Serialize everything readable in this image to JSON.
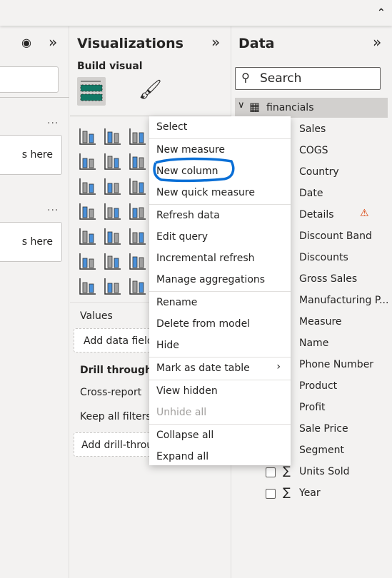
{
  "filters": {
    "box1_text": "Add data fields here",
    "box2_text": "Add data fields here",
    "more_label": "...",
    "box1_visible": "s here",
    "box2_visible": "s here"
  },
  "visualizations": {
    "title": "Visualizations",
    "build_visual": "Build visual",
    "values_label": "Values",
    "add_data_fields": "Add data fields here",
    "drill_through": "Drill through",
    "cross_report": "Cross-report",
    "keep_all_filters": "Keep all filters",
    "add_drill_through": "Add drill-through fields here",
    "icons": [
      "stacked-bar-chart",
      "stacked-column-chart",
      "clustered-bar-chart",
      "line-chart",
      "area-chart",
      "stacked-area-chart",
      "line-and-column-chart",
      "funnel-chart",
      "scatter-chart",
      "globe-map",
      "filled-map",
      "azure-map",
      "kpi",
      "slicer",
      "table",
      "decomposition-tree",
      "key-influencers",
      "smart-narrative",
      "card-new",
      "arcgis-map",
      "power-apps"
    ]
  },
  "data": {
    "title": "Data",
    "search_placeholder": "Search",
    "table_name": "financials",
    "fields": [
      {
        "label": "Sales",
        "sigma": true
      },
      {
        "label": "COGS",
        "sigma": true
      },
      {
        "label": "Country",
        "sigma": false
      },
      {
        "label": "Date",
        "sigma": false
      },
      {
        "label": "Details",
        "sigma": false,
        "warning": true
      },
      {
        "label": "Discount Band",
        "sigma": false
      },
      {
        "label": "Discounts",
        "sigma": true
      },
      {
        "label": "Gross Sales",
        "sigma": true
      },
      {
        "label": "Manufacturing P...",
        "sigma": true
      },
      {
        "label": "Measure",
        "sigma": false
      },
      {
        "label": "Name",
        "sigma": false
      },
      {
        "label": "Phone Number",
        "sigma": false
      },
      {
        "label": "Product",
        "sigma": false
      },
      {
        "label": "Profit",
        "sigma": true
      },
      {
        "label": "Sale Price",
        "sigma": true
      },
      {
        "label": "Segment",
        "sigma": false
      },
      {
        "label": "Units Sold",
        "sigma": true
      },
      {
        "label": "Year",
        "sigma": true
      }
    ]
  },
  "context_menu": {
    "items": [
      {
        "label": "Select"
      },
      {
        "sep": true
      },
      {
        "label": "New measure"
      },
      {
        "label": "New column",
        "highlighted": true
      },
      {
        "label": "New quick measure"
      },
      {
        "sep": true
      },
      {
        "label": "Refresh data"
      },
      {
        "label": "Edit query"
      },
      {
        "label": "Incremental refresh"
      },
      {
        "label": "Manage aggregations"
      },
      {
        "sep": true
      },
      {
        "label": "Rename"
      },
      {
        "label": "Delete from model"
      },
      {
        "label": "Hide"
      },
      {
        "sep": true
      },
      {
        "label": "Mark as date table",
        "submenu": true
      },
      {
        "sep": true
      },
      {
        "label": "View hidden"
      },
      {
        "label": "Unhide all",
        "disabled": true
      },
      {
        "sep": true
      },
      {
        "label": "Collapse all"
      },
      {
        "label": "Expand all"
      }
    ]
  },
  "colors": {
    "accent": "#0078d4",
    "highlight_circle": "#0a6fd6",
    "selected_row": "#d2d0ce",
    "warning": "#d83b01",
    "viz_green": "#117865"
  }
}
